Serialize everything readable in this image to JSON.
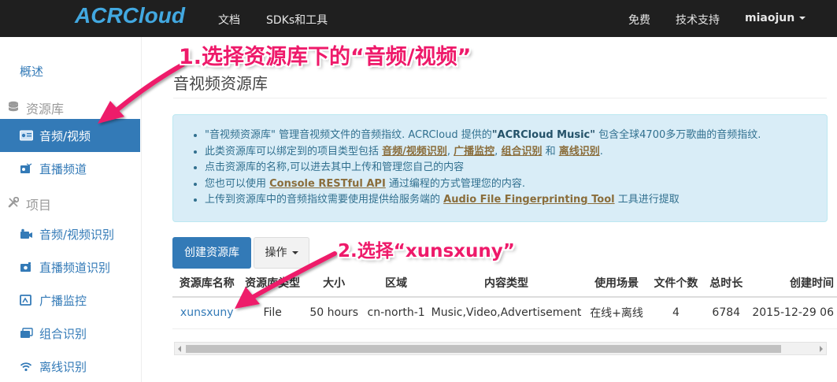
{
  "navbar": {
    "logo": "ACRCloud",
    "links": [
      "文档",
      "SDKs和工具"
    ],
    "right_links": [
      "免费",
      "技术支持"
    ],
    "user": "miaojun"
  },
  "sidebar": {
    "overview": "概述",
    "group1": "资源库",
    "items1": [
      "音频/视频",
      "直播频道"
    ],
    "group2": "项目",
    "items2": [
      "音频/视频识别",
      "直播频道识别",
      "广播监控",
      "组合识别",
      "离线识别"
    ]
  },
  "main": {
    "title": "音视频资源库",
    "info": {
      "l1_a": "\"音视频资源库\" 管理音视频文件的音频指纹. ACRCloud 提供的",
      "l1_b": "\"ACRCloud Music\"",
      "l1_c": " 包含全球4700多万歌曲的音频指纹.",
      "l2_a": "此类资源库可以绑定到的项目类型包括 ",
      "l2_link1": "音频/视频识别",
      "l2_sep1": ", ",
      "l2_link2": "广播监控",
      "l2_sep2": ", ",
      "l2_link3": "组合识别",
      "l2_and": " 和 ",
      "l2_link4": "离线识别",
      "l2_end": ".",
      "l3": "点击资源库的名称,可以进去其中上传和管理您自己的内容",
      "l4_a": "您也可以使用 ",
      "l4_link": "Console RESTful API",
      "l4_b": " 通过编程的方式管理您的内容.",
      "l5_a": "上传到资源库中的音频指纹需要使用提供给服务端的 ",
      "l5_link": "Audio File Fingerprinting Tool",
      "l5_b": " 工具进行提取"
    },
    "buttons": {
      "create": "创建资源库",
      "ops": "操作"
    },
    "table": {
      "headers": [
        "资源库名称",
        "资源库类型",
        "大小",
        "区域",
        "内容类型",
        "使用场景",
        "文件个数",
        "总时长",
        "创建时间"
      ],
      "rows": [
        [
          "xunsxuny",
          "File",
          "50 hours",
          "cn-north-1",
          "Music,Video,Advertisement",
          "在线+离线",
          "4",
          "6784",
          "2015-12-29 06"
        ]
      ]
    }
  },
  "annotations": {
    "step1": "1.选择资源库下的“音频/视频”",
    "step2": "2.选择“xunsxuny”",
    "color": "#ee1a6a"
  }
}
